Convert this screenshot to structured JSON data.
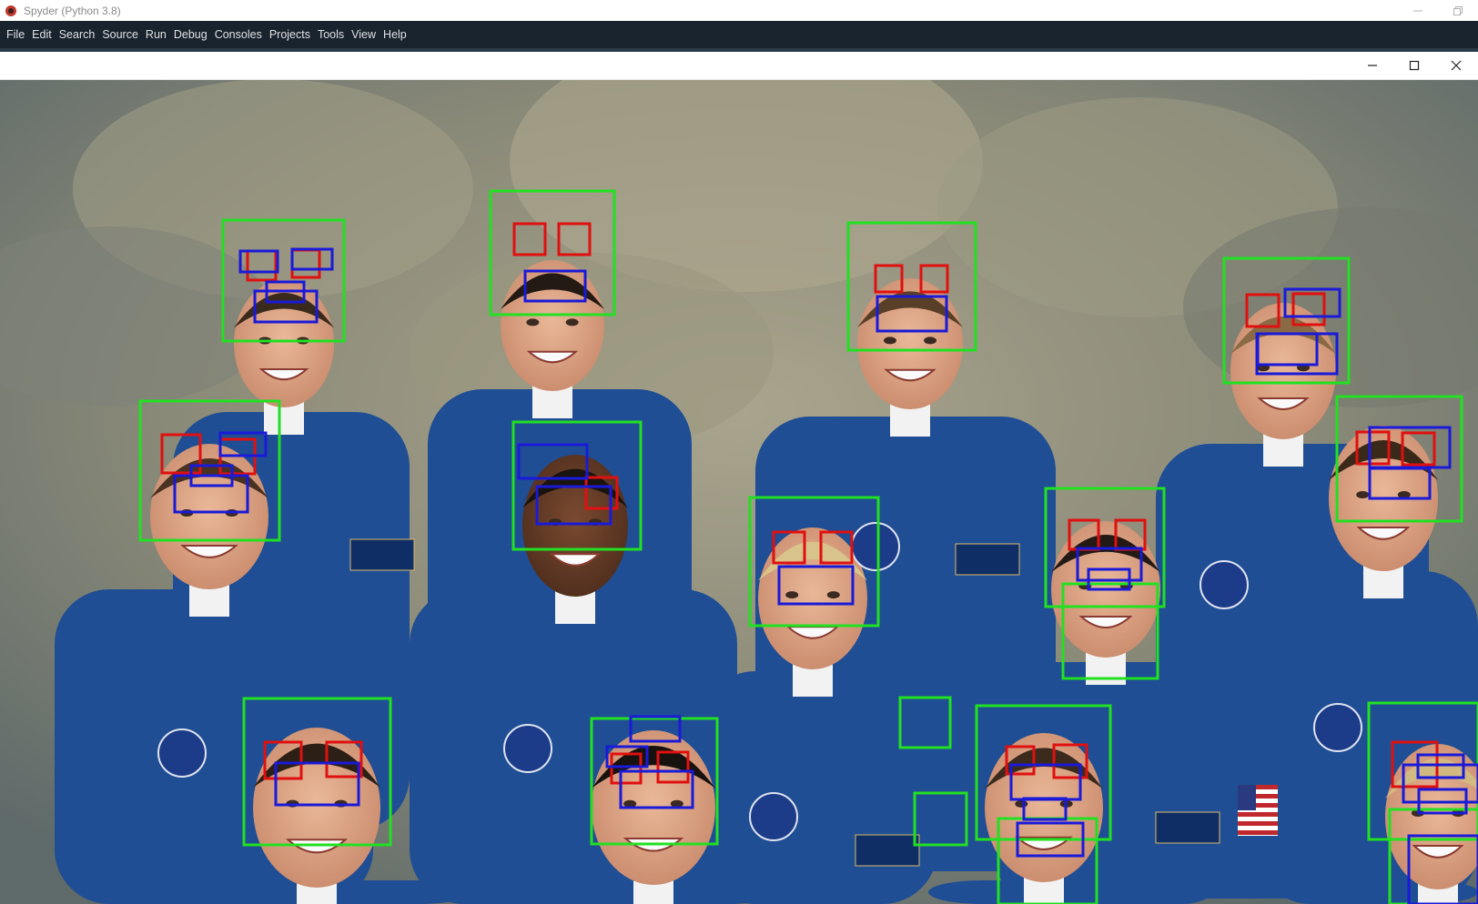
{
  "app": {
    "title": "Spyder (Python 3.8)"
  },
  "menu": [
    {
      "label": "File"
    },
    {
      "label": "Edit"
    },
    {
      "label": "Search"
    },
    {
      "label": "Source"
    },
    {
      "label": "Run"
    },
    {
      "label": "Debug"
    },
    {
      "label": "Consoles"
    },
    {
      "label": "Projects"
    },
    {
      "label": "Tools"
    },
    {
      "label": "View"
    },
    {
      "label": "Help"
    }
  ],
  "image_window": {
    "title": "",
    "controls": [
      "minimize-icon",
      "maximize-icon",
      "close-icon"
    ]
  },
  "colors": {
    "menubar_bg": "#19232d",
    "face_box": "#22e022",
    "eye_box": "#e01010",
    "mouth_box": "#1a1ad8",
    "uniform": "#1f4e94",
    "backdrop": "#8f8c7a"
  },
  "detections": {
    "face_count": 16,
    "classes": [
      "face",
      "eye",
      "smile"
    ]
  }
}
